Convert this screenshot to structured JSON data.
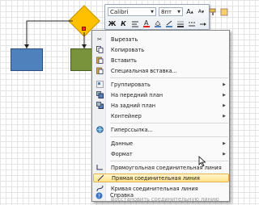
{
  "toolbar": {
    "font_name": "Calibri",
    "font_size": "8пт"
  },
  "menu": {
    "items": [
      {
        "label": "Вырезать",
        "icon": "scissors-icon"
      },
      {
        "label": "Копировать",
        "icon": "copy-icon"
      },
      {
        "label": "Вставить",
        "icon": "paste-icon"
      },
      {
        "label": "Специальная вставка...",
        "icon": "paste-special-icon"
      },
      {
        "label": "Группировать",
        "icon": "group-icon",
        "submenu": true
      },
      {
        "label": "На передний план",
        "icon": "bring-front-icon",
        "submenu": true
      },
      {
        "label": "На задний план",
        "icon": "send-back-icon",
        "submenu": true
      },
      {
        "label": "Контейнер",
        "submenu": true
      },
      {
        "label": "Гиперссылка...",
        "icon": "hyperlink-icon"
      },
      {
        "label": "Данные",
        "submenu": true
      },
      {
        "label": "Формат",
        "submenu": true
      },
      {
        "label": "Прямоугольная соединительная линия",
        "icon": "right-angle-connector-icon"
      },
      {
        "label": "Прямая соединительная линия",
        "icon": "straight-connector-icon",
        "highlighted": true
      },
      {
        "label": "Кривая соединительная линия",
        "icon": "curved-connector-icon"
      },
      {
        "label": "Восстановить соединительную линию",
        "disabled": true
      },
      {
        "label": "Справка",
        "icon": "help-icon"
      }
    ]
  },
  "colors": {
    "diamond": "#ffc000",
    "rect_blue": "#4f81bd",
    "rect_green": "#78933c",
    "menu_highlight": "#ffe38c"
  }
}
